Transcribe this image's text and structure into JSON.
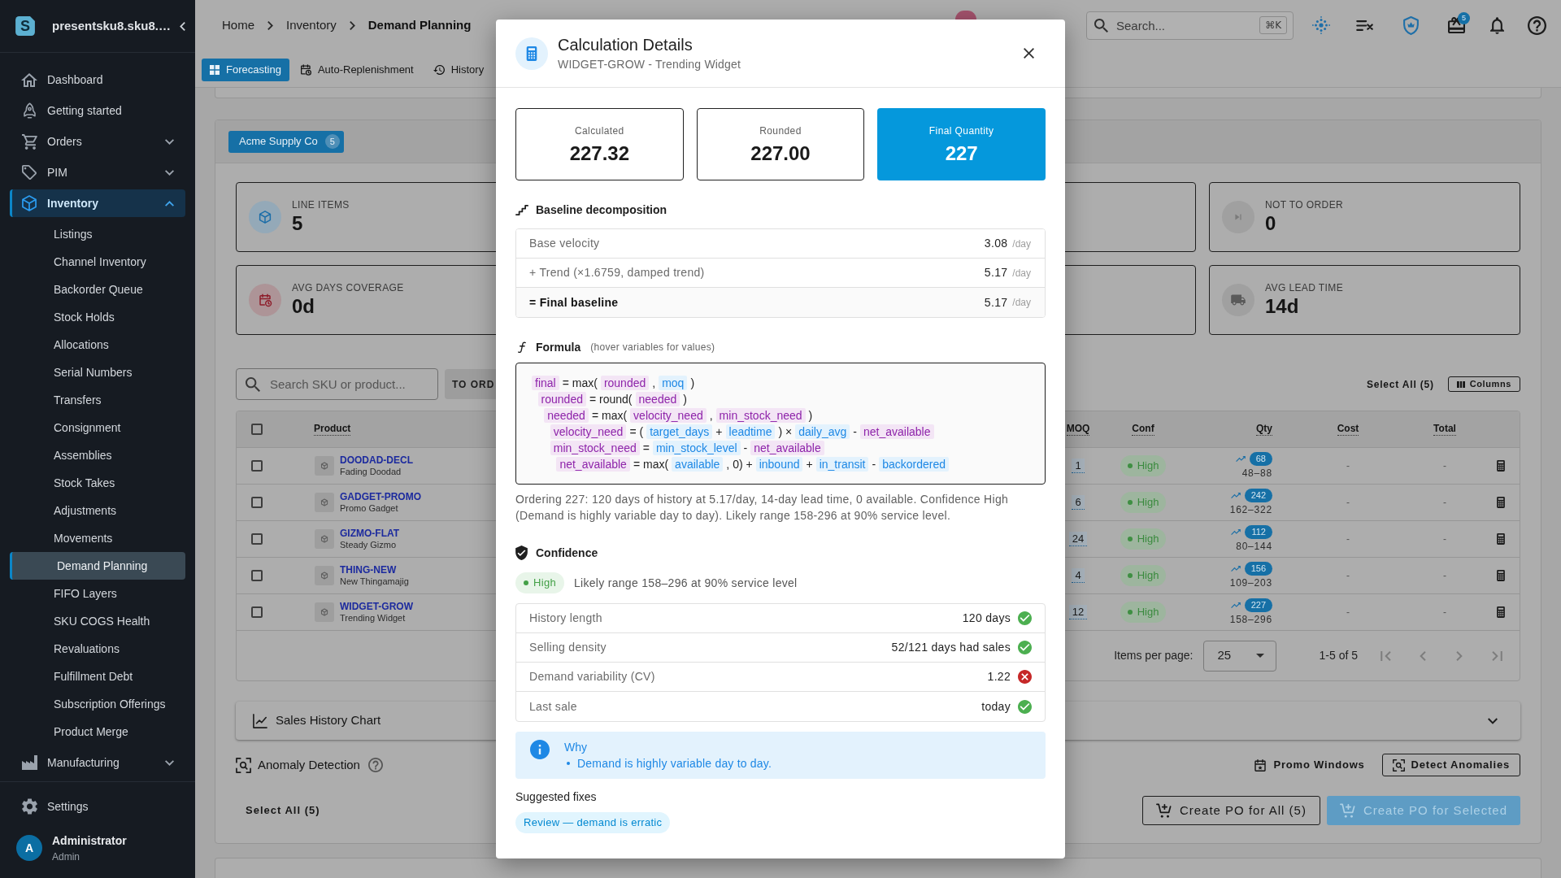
{
  "sidebar": {
    "logo_letter": "S",
    "brand": "presentsku8.sku8.…",
    "items": [
      {
        "label": "Dashboard",
        "kind": "link",
        "selected": false
      },
      {
        "label": "Getting started",
        "kind": "link",
        "selected": false
      },
      {
        "label": "Orders",
        "kind": "group",
        "expanded": false,
        "selected": false
      },
      {
        "label": "PIM",
        "kind": "group",
        "expanded": false,
        "selected": false
      },
      {
        "label": "Inventory",
        "kind": "group",
        "expanded": true,
        "selected": true,
        "children": [
          {
            "label": "Listings",
            "selected": false
          },
          {
            "label": "Channel Inventory",
            "selected": false
          },
          {
            "label": "Backorder Queue",
            "selected": false
          },
          {
            "label": "Stock Holds",
            "selected": false
          },
          {
            "label": "Allocations",
            "selected": false
          },
          {
            "label": "Serial Numbers",
            "selected": false
          },
          {
            "label": "Transfers",
            "selected": false
          },
          {
            "label": "Consignment",
            "selected": false
          },
          {
            "label": "Assemblies",
            "selected": false
          },
          {
            "label": "Stock Takes",
            "selected": false
          },
          {
            "label": "Adjustments",
            "selected": false
          },
          {
            "label": "Movements",
            "selected": false
          },
          {
            "label": "Demand Planning",
            "selected": true
          },
          {
            "label": "FIFO Layers",
            "selected": false
          },
          {
            "label": "SKU COGS Health",
            "selected": false
          },
          {
            "label": "Revaluations",
            "selected": false
          },
          {
            "label": "Fulfillment Debt",
            "selected": false
          },
          {
            "label": "Subscription Offerings",
            "selected": false
          },
          {
            "label": "Product Merge",
            "selected": false
          }
        ]
      },
      {
        "label": "Manufacturing",
        "kind": "group",
        "expanded": false,
        "selected": false
      }
    ],
    "settings": "Settings",
    "user": {
      "initial": "A",
      "name": "Administrator",
      "role": "Admin"
    }
  },
  "header": {
    "breadcrumb": [
      {
        "label": "Home",
        "current": false
      },
      {
        "label": "Inventory",
        "current": false
      },
      {
        "label": "Demand Planning",
        "current": true
      }
    ],
    "search": {
      "placeholder": "Search...",
      "shortcut": "⌘K"
    },
    "gift_badge": "5",
    "tabs": [
      {
        "label": "Forecasting",
        "selected": true
      },
      {
        "label": "Auto-Replenishment",
        "selected": false
      },
      {
        "label": "History",
        "selected": false
      }
    ]
  },
  "supplier": {
    "name": "Acme Supply Co",
    "count": "5"
  },
  "stats": [
    {
      "label": "LINE ITEMS",
      "value": "5"
    },
    {
      "label": "NOT TO ORDER",
      "value": "0"
    },
    {
      "label": "AVG DAYS COVERAGE",
      "value": "0d"
    },
    {
      "label": "AVG LEAD TIME",
      "value": "14d"
    }
  ],
  "toolbar": {
    "search": {
      "placeholder": "Search SKU or product..."
    },
    "filter_button": "TO ORD",
    "select_all": "Select All (5)",
    "columns_button": "Columns"
  },
  "table": {
    "all_checked": false,
    "columns": [
      "Product",
      "MOQ",
      "Conf",
      "Qty",
      "Cost",
      "Total"
    ],
    "rows": [
      {
        "checked": false,
        "sku": "DOODAD-DECL",
        "name": "Fading Doodad",
        "moq": "1",
        "confidence": "High",
        "qty": "68",
        "range": "48–88",
        "cost": "-",
        "total": "-"
      },
      {
        "checked": false,
        "sku": "GADGET-PROMO",
        "name": "Promo Gadget",
        "moq": "6",
        "confidence": "High",
        "qty": "242",
        "range": "162–322",
        "cost": "-",
        "total": "-"
      },
      {
        "checked": false,
        "sku": "GIZMO-FLAT",
        "name": "Steady Gizmo",
        "moq": "24",
        "confidence": "High",
        "qty": "112",
        "range": "80–144",
        "cost": "-",
        "total": "-"
      },
      {
        "checked": false,
        "sku": "THING-NEW",
        "name": "New Thingamajig",
        "moq": "4",
        "confidence": "High",
        "qty": "156",
        "range": "109–203",
        "cost": "-",
        "total": "-"
      },
      {
        "checked": false,
        "sku": "WIDGET-GROW",
        "name": "Trending Widget",
        "moq": "12",
        "confidence": "High",
        "qty": "227",
        "range": "158–296",
        "cost": "-",
        "total": "-"
      }
    ],
    "pagination": {
      "label": "Items per page:",
      "page_size": "25",
      "range": "1-5 of 5"
    }
  },
  "sales_history": {
    "title": "Sales History Chart",
    "expanded": false
  },
  "anomaly": {
    "title": "Anomaly Detection",
    "buttons": [
      {
        "label": "Promo Windows",
        "kind": "text"
      },
      {
        "label": "Detect Anomalies",
        "kind": "outlined"
      }
    ]
  },
  "footer": {
    "select_all": "Select All (5)",
    "buttons": [
      {
        "label": "Create PO for All (5)",
        "kind": "outlined",
        "disabled": false
      },
      {
        "label": "Create PO for Selected",
        "kind": "filled",
        "disabled": true
      }
    ]
  },
  "dialog": {
    "title": "Calculation Details",
    "subtitle": "WIDGET-GROW - Trending Widget",
    "summary": [
      {
        "label": "Calculated",
        "value": "227.32",
        "highlighted": false
      },
      {
        "label": "Rounded",
        "value": "227.00",
        "highlighted": false
      },
      {
        "label": "Final Quantity",
        "value": "227",
        "highlighted": true
      }
    ],
    "baseline": {
      "title": "Baseline decomposition",
      "rows": [
        {
          "label": "Base velocity",
          "value": "3.08",
          "unit": "/day",
          "total": false
        },
        {
          "label": "+ Trend (×1.6759, damped trend)",
          "value": "5.17",
          "unit": "/day",
          "total": false
        },
        {
          "label": "= Final baseline",
          "value": "5.17",
          "unit": "/day",
          "total": true
        }
      ]
    },
    "formula": {
      "title": "Formula",
      "hint": "(hover variables for values)",
      "lines": [
        {
          "tokens": [
            {
              "kind": "derived",
              "text": "final"
            },
            {
              "kind": "operator",
              "text": "= max("
            },
            {
              "kind": "derived",
              "text": "rounded"
            },
            {
              "kind": "operator",
              "text": ","
            },
            {
              "kind": "input",
              "text": "moq"
            },
            {
              "kind": "operator",
              "text": ")"
            }
          ],
          "children": [
            {
              "tokens": [
                {
                  "kind": "derived",
                  "text": "rounded"
                },
                {
                  "kind": "operator",
                  "text": "= round("
                },
                {
                  "kind": "derived",
                  "text": "needed"
                },
                {
                  "kind": "operator",
                  "text": ")"
                }
              ],
              "children": [
                {
                  "tokens": [
                    {
                      "kind": "derived",
                      "text": "needed"
                    },
                    {
                      "kind": "operator",
                      "text": "= max("
                    },
                    {
                      "kind": "derived",
                      "text": "velocity_need"
                    },
                    {
                      "kind": "operator",
                      "text": ","
                    },
                    {
                      "kind": "derived",
                      "text": "min_stock_need"
                    },
                    {
                      "kind": "operator",
                      "text": ")"
                    }
                  ],
                  "children": [
                    {
                      "tokens": [
                        {
                          "kind": "derived",
                          "text": "velocity_need"
                        },
                        {
                          "kind": "operator",
                          "text": "= ("
                        },
                        {
                          "kind": "input",
                          "text": "target_days"
                        },
                        {
                          "kind": "operator",
                          "text": "+"
                        },
                        {
                          "kind": "input",
                          "text": "leadtime"
                        },
                        {
                          "kind": "operator",
                          "text": ") ×"
                        },
                        {
                          "kind": "input",
                          "text": "daily_avg"
                        },
                        {
                          "kind": "operator",
                          "text": "-"
                        },
                        {
                          "kind": "derived",
                          "text": "net_available"
                        }
                      ]
                    },
                    {
                      "tokens": [
                        {
                          "kind": "derived",
                          "text": "min_stock_need"
                        },
                        {
                          "kind": "operator",
                          "text": "="
                        },
                        {
                          "kind": "input",
                          "text": "min_stock_level"
                        },
                        {
                          "kind": "operator",
                          "text": "-"
                        },
                        {
                          "kind": "derived",
                          "text": "net_available"
                        }
                      ],
                      "children": [
                        {
                          "tokens": [
                            {
                              "kind": "derived",
                              "text": "net_available"
                            },
                            {
                              "kind": "operator",
                              "text": "= max("
                            },
                            {
                              "kind": "input",
                              "text": "available"
                            },
                            {
                              "kind": "operator",
                              "text": ", 0) +"
                            },
                            {
                              "kind": "input",
                              "text": "inbound"
                            },
                            {
                              "kind": "operator",
                              "text": "+"
                            },
                            {
                              "kind": "input",
                              "text": "in_transit"
                            },
                            {
                              "kind": "operator",
                              "text": "-"
                            },
                            {
                              "kind": "input",
                              "text": "backordered"
                            }
                          ]
                        }
                      ]
                    }
                  ]
                }
              ]
            }
          ]
        }
      ]
    },
    "explanation": "Ordering 227: 120 days of history at 5.17/day, 14-day lead time, 0 available. Confidence High (Demand is highly variable day to day). Likely range 158-296 at 90% service level.",
    "confidence": {
      "title": "Confidence",
      "rating": "High",
      "range": "Likely range 158–296 at 90% service level",
      "checks": [
        {
          "label": "History length",
          "value": "120 days",
          "ok": true
        },
        {
          "label": "Selling density",
          "value": "52/121 days had sales",
          "ok": true
        },
        {
          "label": "Demand variability (CV)",
          "value": "1.22",
          "ok": false
        },
        {
          "label": "Last sale",
          "value": "today",
          "ok": true
        }
      ]
    },
    "why": {
      "title": "Why",
      "items": [
        "Demand is highly variable day to day."
      ]
    },
    "fixes": {
      "title": "Suggested fixes",
      "items": [
        "Review — demand is erratic"
      ]
    }
  }
}
